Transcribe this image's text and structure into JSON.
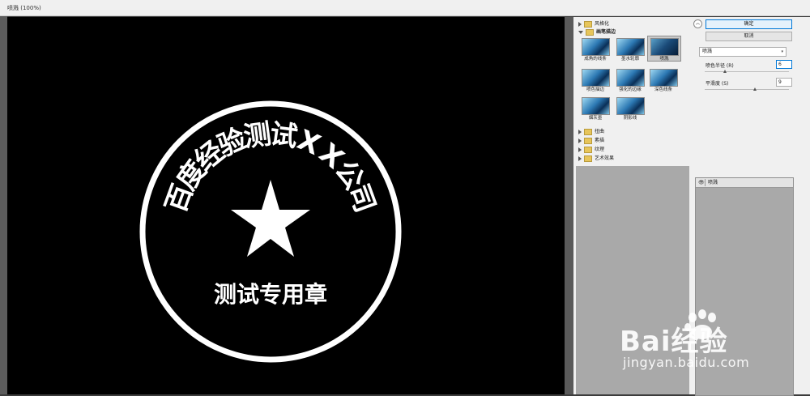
{
  "window": {
    "title": "喷溅 (100%)"
  },
  "stamp": {
    "arc_text": [
      "百",
      "度",
      "经",
      "验",
      "测",
      "试",
      "X",
      "X",
      "公",
      "司"
    ],
    "bottom_text": "测试专用章",
    "center_icon": "star-icon"
  },
  "gallery": {
    "categories_top": [
      {
        "label": "风格化",
        "expanded": false
      }
    ],
    "current_category": {
      "label": "画笔描边",
      "expanded": true
    },
    "filters": [
      {
        "label": "成角的线条",
        "selected": false
      },
      {
        "label": "墨水轮廓",
        "selected": false
      },
      {
        "label": "喷溅",
        "selected": true
      },
      {
        "label": "喷色描边",
        "selected": false
      },
      {
        "label": "强化的边缘",
        "selected": false
      },
      {
        "label": "深色线条",
        "selected": false
      },
      {
        "label": "烟灰墨",
        "selected": false
      },
      {
        "label": "阴影线",
        "selected": false
      }
    ],
    "categories_bottom": [
      {
        "label": "扭曲",
        "expanded": false
      },
      {
        "label": "素描",
        "expanded": false
      },
      {
        "label": "纹理",
        "expanded": false
      },
      {
        "label": "艺术效果",
        "expanded": false
      }
    ]
  },
  "panel": {
    "collapse_icon": "double-chevron-up-icon",
    "ok_label": "确定",
    "cancel_label": "取消",
    "filter_select": "喷溅",
    "params": [
      {
        "label": "喷色半径 (R)",
        "value": "6",
        "slider": 0.24
      },
      {
        "label": "平滑度 (S)",
        "value": "9",
        "slider": 0.6
      }
    ],
    "layer_name": "喷溅",
    "layer_icon": "eye-icon"
  },
  "watermark": {
    "brand": "Bai经验",
    "url": "jingyan.baidu.com"
  }
}
